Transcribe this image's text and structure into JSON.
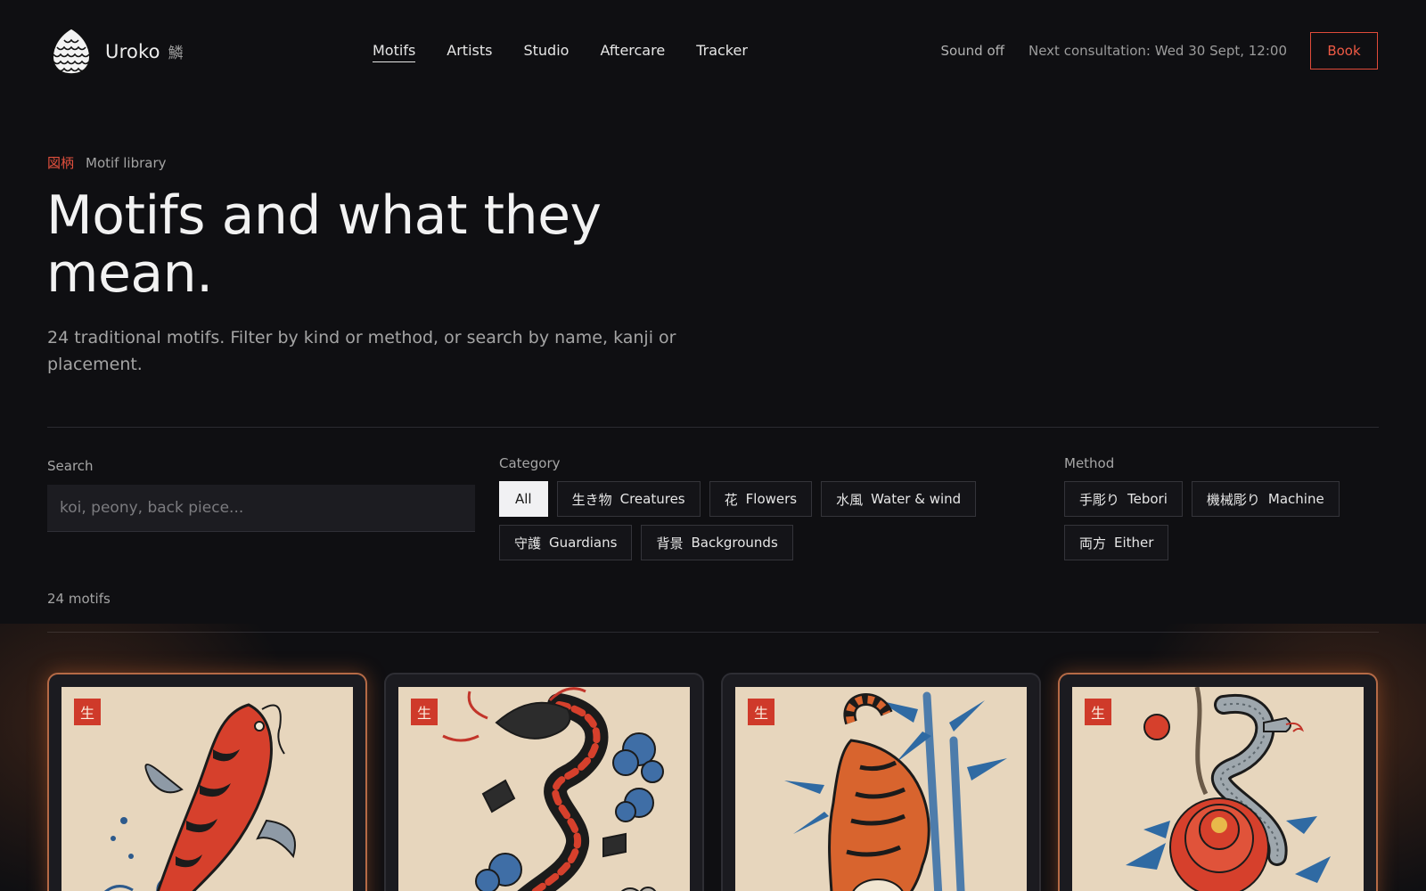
{
  "brand": {
    "name": "Uroko",
    "kanji": "鱗"
  },
  "nav": [
    {
      "label": "Motifs",
      "active": true
    },
    {
      "label": "Artists"
    },
    {
      "label": "Studio"
    },
    {
      "label": "Aftercare"
    },
    {
      "label": "Tracker"
    }
  ],
  "header": {
    "sound": "Sound off",
    "consultation": "Next consultation: Wed 30 Sept, 12:00",
    "book": "Book"
  },
  "hero": {
    "eyebrow_kanji": "図柄",
    "eyebrow_text": "Motif library",
    "title": "Motifs and what they mean.",
    "subtitle": "24 traditional motifs. Filter by kind or method, or search by name, kanji or placement."
  },
  "filters": {
    "search_label": "Search",
    "search_placeholder": "koi, peony, back piece...",
    "category_label": "Category",
    "categories": [
      {
        "kanji": "",
        "label": "All",
        "active": true
      },
      {
        "kanji": "生き物",
        "label": "Creatures"
      },
      {
        "kanji": "花",
        "label": "Flowers"
      },
      {
        "kanji": "水風",
        "label": "Water & wind"
      },
      {
        "kanji": "守護",
        "label": "Guardians"
      },
      {
        "kanji": "背景",
        "label": "Backgrounds"
      }
    ],
    "method_label": "Method",
    "methods": [
      {
        "kanji": "手彫り",
        "label": "Tebori"
      },
      {
        "kanji": "機械彫り",
        "label": "Machine"
      },
      {
        "kanji": "両方",
        "label": "Either"
      }
    ]
  },
  "results": {
    "count": "24 motifs"
  },
  "cards": [
    {
      "badge": "生",
      "art": "koi-illustration"
    },
    {
      "badge": "生",
      "art": "dragon-illustration"
    },
    {
      "badge": "生",
      "art": "tiger-illustration"
    },
    {
      "badge": "生",
      "art": "snake-peony-illustration"
    }
  ],
  "colors": {
    "background": "#0f0f12",
    "accent": "#e04b3a",
    "paper": "#e7d6bd",
    "badge": "#cf3a2a"
  }
}
